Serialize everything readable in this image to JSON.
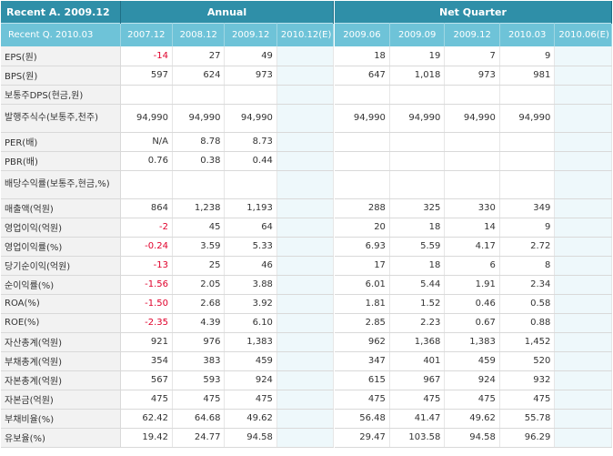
{
  "header": {
    "recent_annual": "Recent A. 2009.12",
    "annual": "Annual",
    "net_quarter": "Net Quarter",
    "recent_quarter": "Recent Q. 2010.03",
    "annual_periods": [
      "2007.12",
      "2008.12",
      "2009.12",
      "2010.12(E)"
    ],
    "quarter_periods": [
      "2009.06",
      "2009.09",
      "2009.12",
      "2010.03",
      "2010.06(E)"
    ]
  },
  "rows": [
    {
      "label": "EPS(원)",
      "annual": [
        "-14",
        "27",
        "49",
        ""
      ],
      "quarter": [
        "18",
        "19",
        "7",
        "9",
        ""
      ]
    },
    {
      "label": "BPS(원)",
      "annual": [
        "597",
        "624",
        "973",
        ""
      ],
      "quarter": [
        "647",
        "1,018",
        "973",
        "981",
        ""
      ]
    },
    {
      "label": "보통주DPS(현금,원)",
      "annual": [
        "",
        "",
        "",
        ""
      ],
      "quarter": [
        "",
        "",
        "",
        "",
        ""
      ]
    },
    {
      "label": "발행주식수(보통주,천주)",
      "annual": [
        "94,990",
        "94,990",
        "94,990",
        ""
      ],
      "quarter": [
        "94,990",
        "94,990",
        "94,990",
        "94,990",
        ""
      ]
    },
    {
      "label": "PER(배)",
      "annual": [
        "N/A",
        "8.78",
        "8.73",
        ""
      ],
      "quarter": [
        "",
        "",
        "",
        "",
        ""
      ]
    },
    {
      "label": "PBR(배)",
      "annual": [
        "0.76",
        "0.38",
        "0.44",
        ""
      ],
      "quarter": [
        "",
        "",
        "",
        "",
        ""
      ]
    },
    {
      "label": "배당수익률(보통주,현금,%)",
      "annual": [
        "",
        "",
        "",
        ""
      ],
      "quarter": [
        "",
        "",
        "",
        "",
        ""
      ]
    },
    {
      "label": "매출액(억원)",
      "annual": [
        "864",
        "1,238",
        "1,193",
        ""
      ],
      "quarter": [
        "288",
        "325",
        "330",
        "349",
        ""
      ]
    },
    {
      "label": "영업이익(억원)",
      "annual": [
        "-2",
        "45",
        "64",
        ""
      ],
      "quarter": [
        "20",
        "18",
        "14",
        "9",
        ""
      ]
    },
    {
      "label": "영업이익률(%)",
      "annual": [
        "-0.24",
        "3.59",
        "5.33",
        ""
      ],
      "quarter": [
        "6.93",
        "5.59",
        "4.17",
        "2.72",
        ""
      ]
    },
    {
      "label": "당기순이익(억원)",
      "annual": [
        "-13",
        "25",
        "46",
        ""
      ],
      "quarter": [
        "17",
        "18",
        "6",
        "8",
        ""
      ]
    },
    {
      "label": "순이익률(%)",
      "annual": [
        "-1.56",
        "2.05",
        "3.88",
        ""
      ],
      "quarter": [
        "6.01",
        "5.44",
        "1.91",
        "2.34",
        ""
      ]
    },
    {
      "label": "ROA(%)",
      "annual": [
        "-1.50",
        "2.68",
        "3.92",
        ""
      ],
      "quarter": [
        "1.81",
        "1.52",
        "0.46",
        "0.58",
        ""
      ]
    },
    {
      "label": "ROE(%)",
      "annual": [
        "-2.35",
        "4.39",
        "6.10",
        ""
      ],
      "quarter": [
        "2.85",
        "2.23",
        "0.67",
        "0.88",
        ""
      ]
    },
    {
      "label": "자산총계(억원)",
      "annual": [
        "921",
        "976",
        "1,383",
        ""
      ],
      "quarter": [
        "962",
        "1,368",
        "1,383",
        "1,452",
        ""
      ]
    },
    {
      "label": "부채총계(억원)",
      "annual": [
        "354",
        "383",
        "459",
        ""
      ],
      "quarter": [
        "347",
        "401",
        "459",
        "520",
        ""
      ]
    },
    {
      "label": "자본총계(억원)",
      "annual": [
        "567",
        "593",
        "924",
        ""
      ],
      "quarter": [
        "615",
        "967",
        "924",
        "932",
        ""
      ]
    },
    {
      "label": "자본금(억원)",
      "annual": [
        "475",
        "475",
        "475",
        ""
      ],
      "quarter": [
        "475",
        "475",
        "475",
        "475",
        ""
      ]
    },
    {
      "label": "부채비율(%)",
      "annual": [
        "62.42",
        "64.68",
        "49.62",
        ""
      ],
      "quarter": [
        "56.48",
        "41.47",
        "49.62",
        "55.78",
        ""
      ]
    },
    {
      "label": "유보율(%)",
      "annual": [
        "19.42",
        "24.77",
        "94.58",
        ""
      ],
      "quarter": [
        "29.47",
        "103.58",
        "94.58",
        "96.29",
        ""
      ]
    }
  ],
  "colors": {
    "header_dark": "#2f8fa8",
    "header_light": "#6ec3d8",
    "negative": "#e0002b",
    "label_bg": "#f2f2f2",
    "estimate_bg": "#eef8fb"
  }
}
